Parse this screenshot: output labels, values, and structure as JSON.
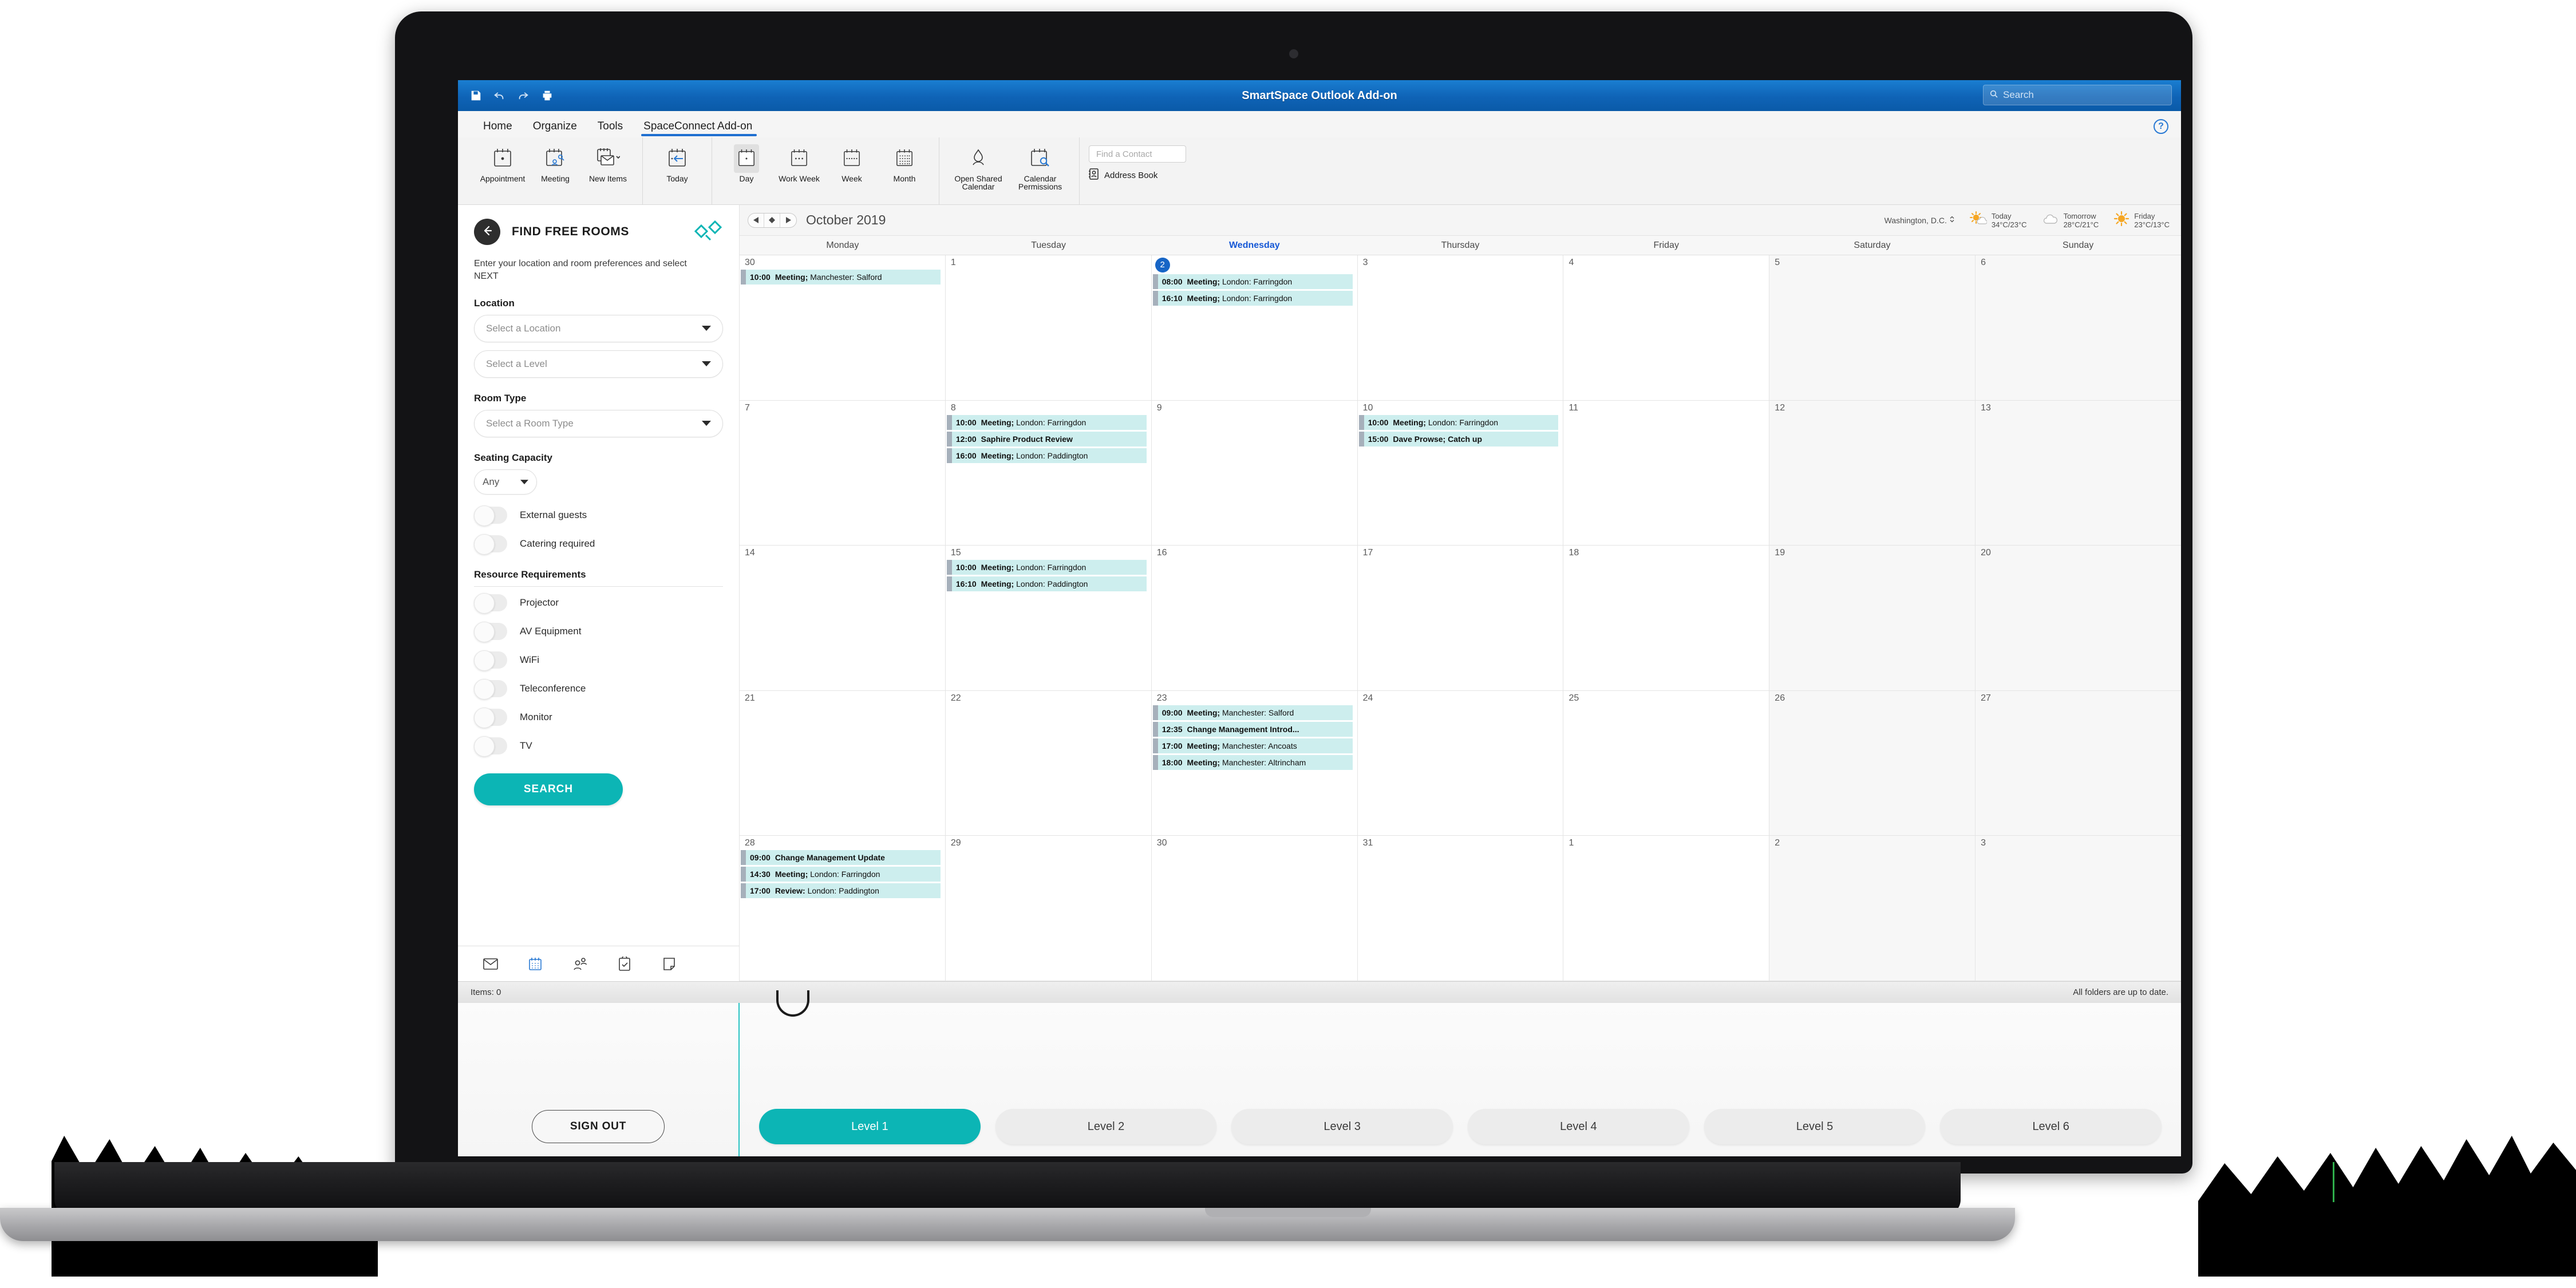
{
  "window": {
    "title": "SmartSpace Outlook Add-on",
    "search_placeholder": "Search",
    "quick_access": [
      "save-icon",
      "undo-icon",
      "redo-icon",
      "print-icon"
    ]
  },
  "ribbon": {
    "tabs": [
      {
        "label": "Home",
        "active": false
      },
      {
        "label": "Organize",
        "active": false
      },
      {
        "label": "Tools",
        "active": false
      },
      {
        "label": "SpaceConnect Add-on",
        "active": true
      }
    ],
    "help_label": "?",
    "groups": [
      {
        "name": "new",
        "items": [
          {
            "label": "Appointment",
            "icon": "calendar-appointment-icon",
            "selected": false
          },
          {
            "label": "Meeting",
            "icon": "calendar-meeting-icon",
            "selected": false
          },
          {
            "label": "New\nItems",
            "icon": "new-items-icon",
            "selected": false
          }
        ]
      },
      {
        "name": "goto",
        "items": [
          {
            "label": "Today",
            "icon": "today-icon",
            "selected": false
          }
        ]
      },
      {
        "name": "arrange",
        "items": [
          {
            "label": "Day",
            "icon": "day-view-icon",
            "selected": true
          },
          {
            "label": "Work\nWeek",
            "icon": "work-week-view-icon",
            "selected": false
          },
          {
            "label": "Week",
            "icon": "week-view-icon",
            "selected": false
          },
          {
            "label": "Month",
            "icon": "month-view-icon",
            "selected": false
          }
        ]
      },
      {
        "name": "manage",
        "items": [
          {
            "label": "Open Shared\nCalendar",
            "icon": "open-shared-calendar-icon",
            "selected": false
          },
          {
            "label": "Calendar\nPermissions",
            "icon": "calendar-permissions-icon",
            "selected": false
          }
        ]
      }
    ],
    "find_contact_placeholder": "Find a Contact",
    "address_book_label": "Address Book"
  },
  "sidebar": {
    "title": "FIND FREE ROOMS",
    "instruction": "Enter your location and room preferences and select NEXT",
    "location_label": "Location",
    "location_placeholder": "Select a Location",
    "level_placeholder": "Select a Level",
    "room_type_label": "Room Type",
    "room_type_placeholder": "Select a Room Type",
    "seating_label": "Seating Capacity",
    "seating_value": "Any",
    "options": [
      {
        "label": "External guests",
        "on": false
      },
      {
        "label": "Catering required",
        "on": false
      }
    ],
    "resources_label": "Resource Requirements",
    "resources": [
      {
        "label": "Projector",
        "on": false
      },
      {
        "label": "AV Equipment",
        "on": false
      },
      {
        "label": "WiFi",
        "on": false
      },
      {
        "label": "Teleconference",
        "on": false
      },
      {
        "label": "Monitor",
        "on": false
      },
      {
        "label": "TV",
        "on": false
      }
    ],
    "search_label": "SEARCH",
    "nav_icons": [
      "mail-icon",
      "calendar-icon",
      "people-icon",
      "tasks-icon",
      "notes-icon"
    ]
  },
  "calendar": {
    "month_label": "October 2019",
    "weather_location": "Washington, D.C.",
    "weather": [
      {
        "day": "Today",
        "temp": "34°C/23°C",
        "icon": "sun-cloud-icon"
      },
      {
        "day": "Tomorrow",
        "temp": "28°C/21°C",
        "icon": "cloud-icon"
      },
      {
        "day": "Friday",
        "temp": "23°C/13°C",
        "icon": "sun-icon"
      }
    ],
    "day_headers": [
      "Monday",
      "Tuesday",
      "Wednesday",
      "Thursday",
      "Friday",
      "Saturday",
      "Sunday"
    ],
    "today_column_index": 2,
    "weeks": [
      [
        {
          "num": "30",
          "dim": false,
          "today": false,
          "events": [
            {
              "time": "10:00",
              "bold": "Meeting;",
              "rest": " Manchester: Salford"
            }
          ]
        },
        {
          "num": "1",
          "dim": false,
          "today": false,
          "events": []
        },
        {
          "num": "2",
          "dim": false,
          "today": true,
          "events": [
            {
              "time": "08:00",
              "bold": "Meeting;",
              "rest": " London: Farringdon"
            },
            {
              "time": "16:10",
              "bold": "Meeting;",
              "rest": " London: Farringdon"
            }
          ]
        },
        {
          "num": "3",
          "dim": false,
          "today": false,
          "events": []
        },
        {
          "num": "4",
          "dim": false,
          "today": false,
          "events": []
        },
        {
          "num": "5",
          "dim": true,
          "today": false,
          "events": []
        },
        {
          "num": "6",
          "dim": true,
          "today": false,
          "events": []
        }
      ],
      [
        {
          "num": "7",
          "dim": false,
          "today": false,
          "events": []
        },
        {
          "num": "8",
          "dim": false,
          "today": false,
          "events": [
            {
              "time": "10:00",
              "bold": "Meeting;",
              "rest": " London: Farringdon"
            },
            {
              "time": "12:00",
              "bold": "Saphire Product Review",
              "rest": ""
            },
            {
              "time": "16:00",
              "bold": "Meeting;",
              "rest": " London: Paddington"
            }
          ]
        },
        {
          "num": "9",
          "dim": false,
          "today": false,
          "events": []
        },
        {
          "num": "10",
          "dim": false,
          "today": false,
          "events": [
            {
              "time": "10:00",
              "bold": "Meeting;",
              "rest": " London: Farringdon"
            },
            {
              "time": "15:00",
              "bold": "Dave Prowse; Catch up",
              "rest": ""
            }
          ]
        },
        {
          "num": "11",
          "dim": false,
          "today": false,
          "events": []
        },
        {
          "num": "12",
          "dim": true,
          "today": false,
          "events": []
        },
        {
          "num": "13",
          "dim": true,
          "today": false,
          "events": []
        }
      ],
      [
        {
          "num": "14",
          "dim": false,
          "today": false,
          "events": []
        },
        {
          "num": "15",
          "dim": false,
          "today": false,
          "events": [
            {
              "time": "10:00",
              "bold": "Meeting;",
              "rest": " London: Farringdon"
            },
            {
              "time": "16:10",
              "bold": "Meeting;",
              "rest": " London: Paddington"
            }
          ]
        },
        {
          "num": "16",
          "dim": false,
          "today": false,
          "events": []
        },
        {
          "num": "17",
          "dim": false,
          "today": false,
          "events": []
        },
        {
          "num": "18",
          "dim": false,
          "today": false,
          "events": []
        },
        {
          "num": "19",
          "dim": true,
          "today": false,
          "events": []
        },
        {
          "num": "20",
          "dim": true,
          "today": false,
          "events": []
        }
      ],
      [
        {
          "num": "21",
          "dim": false,
          "today": false,
          "events": []
        },
        {
          "num": "22",
          "dim": false,
          "today": false,
          "events": []
        },
        {
          "num": "23",
          "dim": false,
          "today": false,
          "events": [
            {
              "time": "09:00",
              "bold": "Meeting;",
              "rest": " Manchester: Salford"
            },
            {
              "time": "12:35",
              "bold": "Change Management Introd...",
              "rest": ""
            },
            {
              "time": "17:00",
              "bold": "Meeting;",
              "rest": " Manchester: Ancoats"
            },
            {
              "time": "18:00",
              "bold": "Meeting;",
              "rest": " Manchester: Altrincham"
            }
          ]
        },
        {
          "num": "24",
          "dim": false,
          "today": false,
          "events": []
        },
        {
          "num": "25",
          "dim": false,
          "today": false,
          "events": []
        },
        {
          "num": "26",
          "dim": true,
          "today": false,
          "events": []
        },
        {
          "num": "27",
          "dim": true,
          "today": false,
          "events": []
        }
      ],
      [
        {
          "num": "28",
          "dim": false,
          "today": false,
          "events": [
            {
              "time": "09:00",
              "bold": "Change Management Update",
              "rest": ""
            },
            {
              "time": "14:30",
              "bold": "Meeting;",
              "rest": " London: Farringdon"
            },
            {
              "time": "17:00",
              "bold": "Review:",
              "rest": " London: Paddington"
            }
          ]
        },
        {
          "num": "29",
          "dim": false,
          "today": false,
          "events": []
        },
        {
          "num": "30",
          "dim": false,
          "today": false,
          "events": []
        },
        {
          "num": "31",
          "dim": false,
          "today": false,
          "events": []
        },
        {
          "num": "1",
          "dim": false,
          "today": false,
          "events": []
        },
        {
          "num": "2",
          "dim": true,
          "today": false,
          "events": []
        },
        {
          "num": "3",
          "dim": true,
          "today": false,
          "events": []
        }
      ]
    ]
  },
  "statusbar": {
    "items_label": "Items: 0",
    "sync_label": "All folders are up to date."
  },
  "kiosk": {
    "sign_out_label": "SIGN OUT",
    "levels": [
      {
        "label": "Level 1",
        "active": true
      },
      {
        "label": "Level 2",
        "active": false
      },
      {
        "label": "Level 3",
        "active": false
      },
      {
        "label": "Level  5",
        "active": false
      },
      {
        "label": "Level 4",
        "active": false
      },
      {
        "label": "Level 6",
        "active": false
      }
    ],
    "levels_ordered": [
      "Level 1",
      "Level 2",
      "Level 3",
      "Level 4",
      "Level  5",
      "Level 6"
    ]
  },
  "colors": {
    "accent_teal": "#0cb5b5",
    "outlook_blue": "#0f63b6",
    "event_bg": "#cdeeee",
    "today_blue": "#1765c6"
  }
}
